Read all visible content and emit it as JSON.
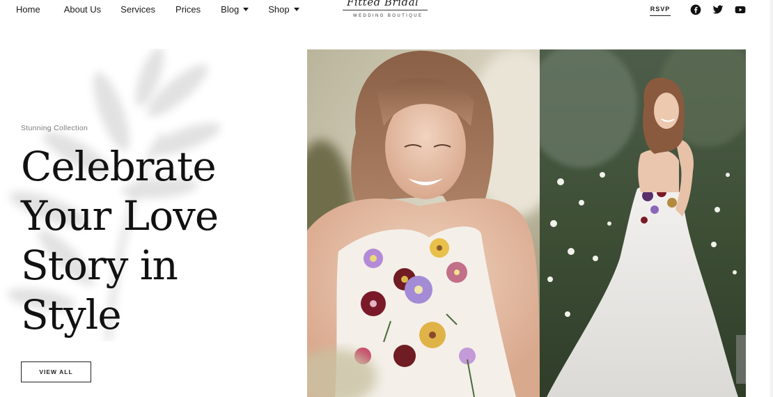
{
  "nav": {
    "items": [
      {
        "label": "Home",
        "has_dropdown": false
      },
      {
        "label": "About Us",
        "has_dropdown": false
      },
      {
        "label": "Services",
        "has_dropdown": false
      },
      {
        "label": "Prices",
        "has_dropdown": false
      },
      {
        "label": "Blog",
        "has_dropdown": true
      },
      {
        "label": "Shop",
        "has_dropdown": true
      }
    ]
  },
  "logo": {
    "script": "Fitted Bridal",
    "subtitle": "WEDDING BOUTIQUE"
  },
  "header": {
    "rsvp_label": "RSVP",
    "social_icons": [
      "facebook-icon",
      "twitter-icon",
      "youtube-icon"
    ]
  },
  "hero": {
    "eyebrow": "Stunning Collection",
    "headline_lines": [
      "Celebrate",
      "Your Love",
      "Story in",
      "Style"
    ],
    "button_label": "VIEW ALL"
  },
  "colors": {
    "text": "#111111",
    "muted": "#7a7a7a",
    "background": "#ffffff"
  }
}
